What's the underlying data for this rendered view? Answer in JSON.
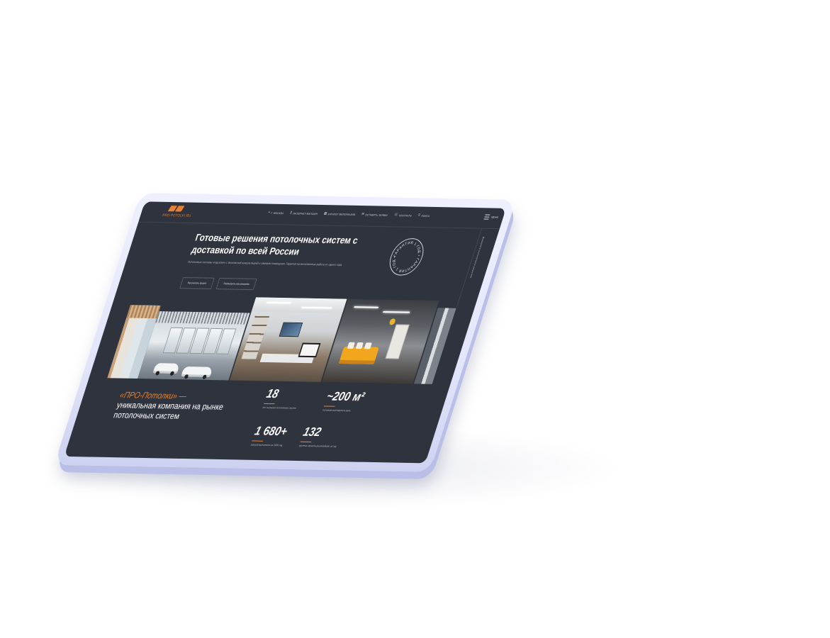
{
  "header": {
    "logo_text": "PRO-POTOLKI.RU",
    "nav": [
      {
        "icon": "location-pin-icon",
        "glyph": "⌖",
        "label": "г. Москва"
      },
      {
        "icon": "cart-icon",
        "glyph": "⊻",
        "label": "Интернет-магазин"
      },
      {
        "icon": "catalog-icon",
        "glyph": "▦",
        "label": "Каталог материалов"
      },
      {
        "icon": "request-icon",
        "glyph": "✉",
        "label": "Оставить заявку"
      },
      {
        "icon": "contacts-icon",
        "glyph": "☏",
        "label": "Контакты"
      },
      {
        "icon": "search-icon",
        "glyph": "⚲",
        "label": "Поиск"
      }
    ],
    "menu_label": "Меню",
    "side_text": "Выберите потолочное решение"
  },
  "hero": {
    "title": "Готовые решения потолочных систем с доставкой по всей России",
    "subtitle": "Потолочные системы «под ключ» с бесплатной консультацией и замером помещения. Гарантия на выполненные работы от одного года.",
    "button_primary": "Рассчитать проект",
    "button_secondary": "Посмотреть все решения",
    "badge_text": "ГАРАНТИЯ 1 ГОД • ГАРАНТИЯ 1 ГОД •"
  },
  "about": {
    "title_accent": "«ПРО-Потолки» —",
    "title_rest": "уникальная компания на рынке потолочных систем"
  },
  "stats": [
    {
      "value": "18",
      "label": "лет на рынке потолочных систем"
    },
    {
      "value": "~200 м²",
      "label": "потолков монтируем в день"
    },
    {
      "value": "1 680+",
      "label": "заказов выполнили за 2020 год"
    },
    {
      "value": "132",
      "label": "крупных проекта реализовано за год"
    }
  ],
  "colors": {
    "accent": "#e9812e",
    "screen_bg": "#2f333d",
    "tablet_frame": "#e6e9fc"
  }
}
